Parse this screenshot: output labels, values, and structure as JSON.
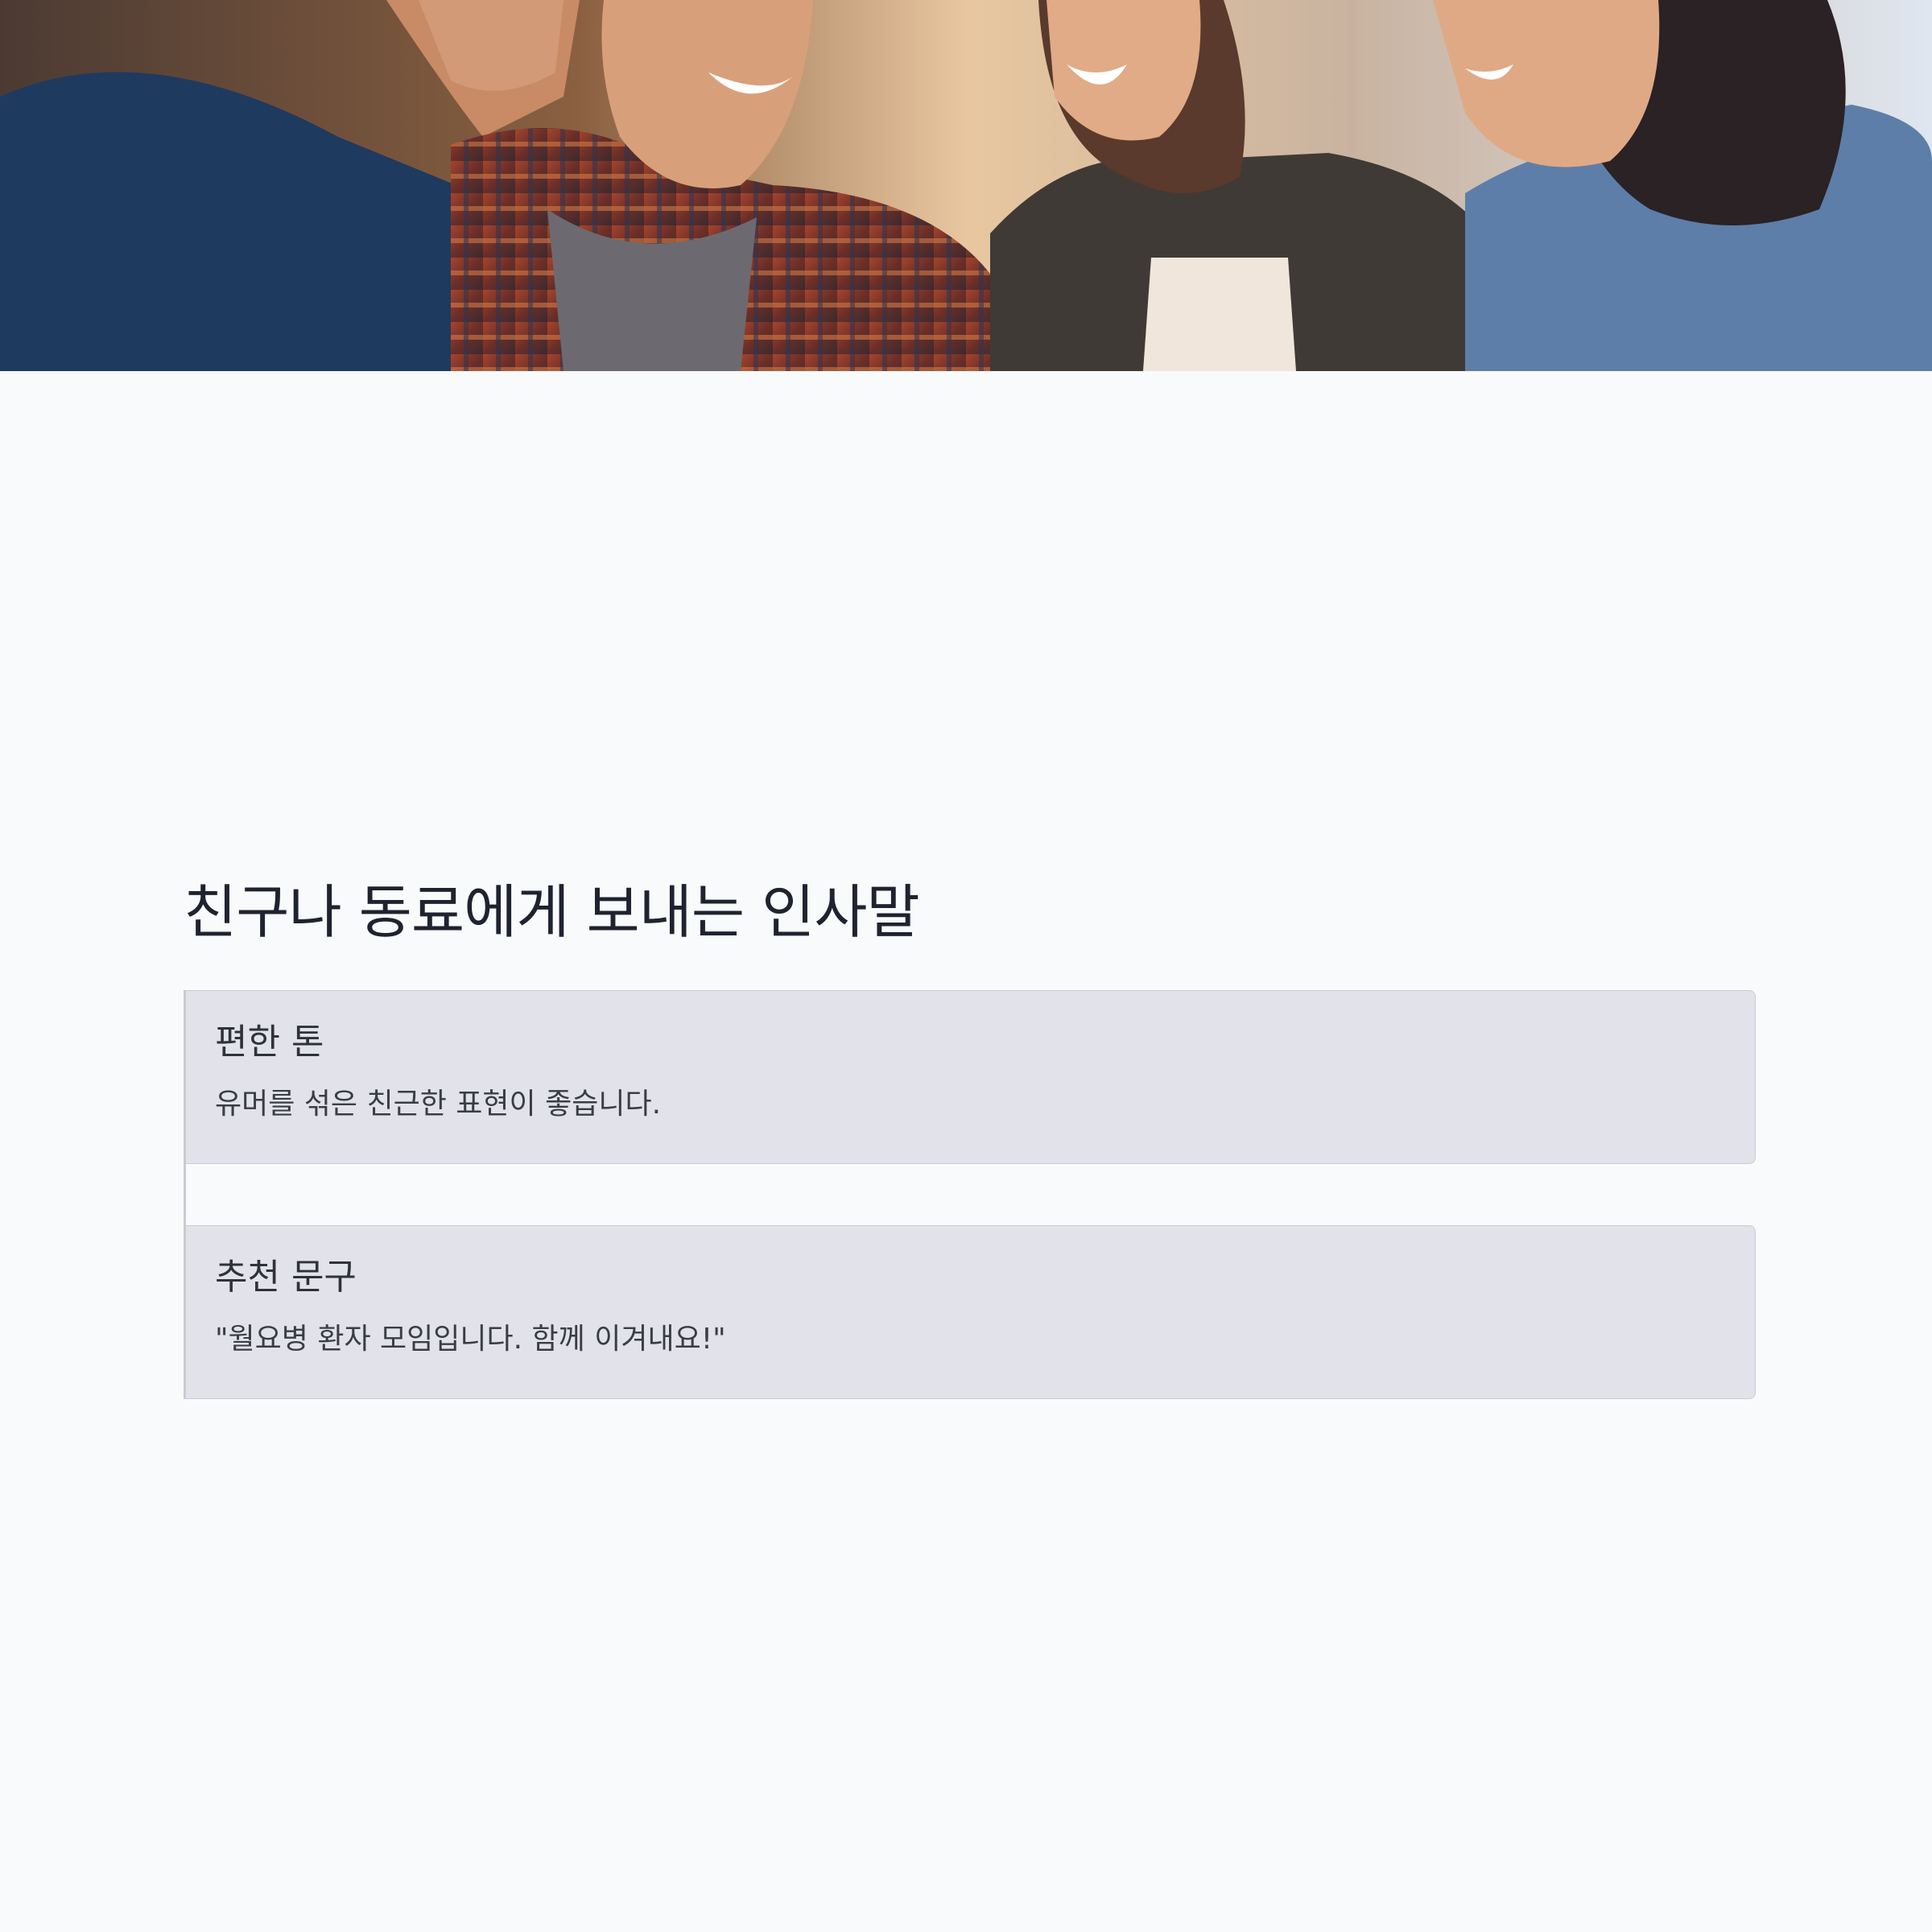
{
  "hero": {
    "image_subject": "four-friends-laughing-photo"
  },
  "main": {
    "title": "친구나 동료에게 보내는 인사말",
    "cards": [
      {
        "title": "편한 톤",
        "text": "유머를 섞은 친근한 표현이 좋습니다."
      },
      {
        "title": "추천 문구",
        "text": "\"월요병 환자 모임입니다. 함께 이겨내요!\""
      }
    ]
  },
  "colors": {
    "background": "#f9fafb",
    "card_background": "#e2e3ea",
    "card_border": "#c9cbd3",
    "title_text": "#1f2330"
  }
}
